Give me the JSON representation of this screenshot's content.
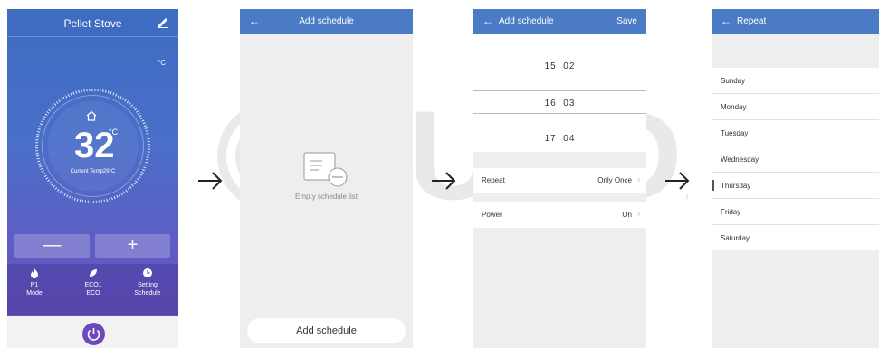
{
  "screen1": {
    "title": "Pellet Stove",
    "unit_toggle": "°C",
    "temperature": "32",
    "temperature_unit": "°C",
    "current_temp": "Current Temp29°C",
    "minus": "—",
    "plus": "+",
    "modes": [
      {
        "value": "P1",
        "label": "Mode",
        "icon": "flame-icon"
      },
      {
        "value": "ECO1",
        "label": "ECO",
        "icon": "leaf-icon"
      },
      {
        "value": "Setting",
        "label": "Schedule",
        "icon": "clock-icon"
      }
    ],
    "accent": "#6d49be"
  },
  "screen2": {
    "title": "Add schedule",
    "empty_text": "Empty schedule list",
    "add_button": "Add schedule"
  },
  "screen3": {
    "title": "Add schedule",
    "save": "Save",
    "picker": [
      {
        "hour": "15",
        "minute": "02"
      },
      {
        "hour": "16",
        "minute": "03"
      },
      {
        "hour": "17",
        "minute": "04"
      }
    ],
    "repeat_label": "Repeat",
    "repeat_value": "Only Once",
    "power_label": "Power",
    "power_value": "On"
  },
  "screen4": {
    "title": "Repeat",
    "days": [
      "Sunday",
      "Monday",
      "Tuesday",
      "Wednesday",
      "Thursday",
      "Friday",
      "Saturday"
    ]
  },
  "watermark": "OLUNDA",
  "header_color": "#4a7bc4"
}
